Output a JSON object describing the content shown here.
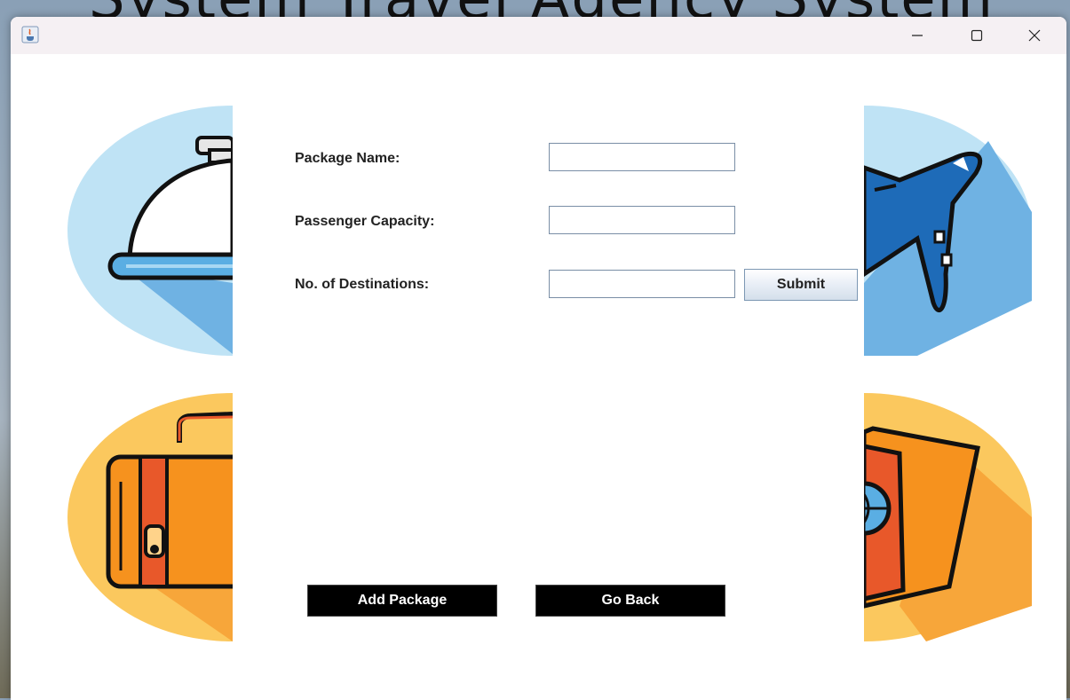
{
  "background_title": "System Travel Agency System",
  "window": {
    "minimize": "—",
    "maximize": "☐",
    "close": "✕"
  },
  "form": {
    "package_name_label": "Package Name:",
    "passenger_capacity_label": "Passenger Capacity:",
    "destinations_label": "No. of Destinations:",
    "package_name_value": "",
    "passenger_capacity_value": "",
    "destinations_value": "",
    "submit_label": "Submit"
  },
  "actions": {
    "add_package_label": "Add Package",
    "go_back_label": "Go Back"
  },
  "icons": [
    "java-icon",
    "bell-icon",
    "airplane-icon",
    "suitcase-icon",
    "passport-icon"
  ],
  "colors": {
    "blue_circle": "#bfe3f5",
    "blue_shadow": "#6fb2e3",
    "orange_circle": "#fbc85e",
    "orange_shadow": "#f7a63a",
    "suitcase": "#f6921e",
    "strap": "#e8582a"
  }
}
